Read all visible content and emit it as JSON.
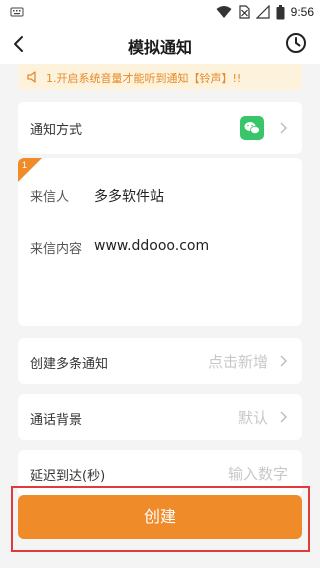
{
  "status_bar": {
    "time": "9:56"
  },
  "nav": {
    "title": "模拟通知"
  },
  "notice": {
    "text": "1.开启系统音量才能听到通知【铃声】!!"
  },
  "notify_method": {
    "label": "通知方式",
    "icon": "wechat-icon"
  },
  "message": {
    "badge": "1",
    "sender_label": "来信人",
    "sender_value": "多多软件站",
    "content_label": "来信内容",
    "content_value": "www.ddooo.com"
  },
  "multi_notify": {
    "label": "创建多条通知",
    "action": "点击新增"
  },
  "call_bg": {
    "label": "通话背景",
    "value": "默认"
  },
  "delay": {
    "label": "延迟到达(秒)",
    "placeholder": "输入数字"
  },
  "create_button": {
    "label": "创建"
  },
  "colors": {
    "accent": "#f08b2a",
    "highlight": "#e03b3b",
    "wechat": "#39c56a"
  }
}
